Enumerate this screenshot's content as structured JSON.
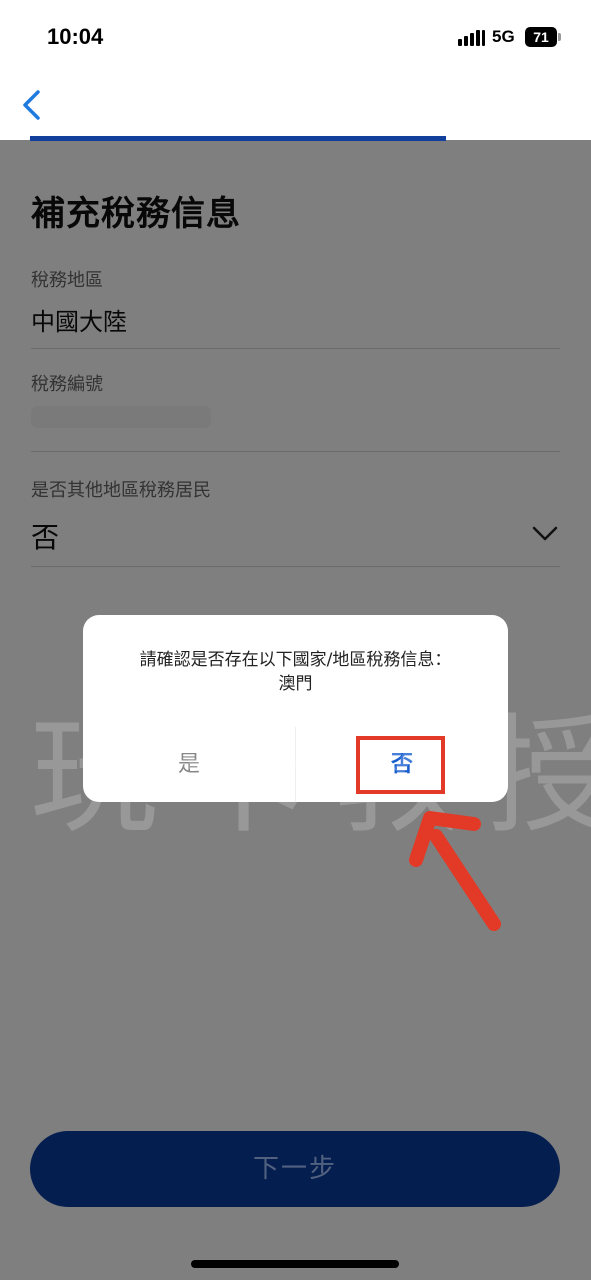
{
  "status_bar": {
    "time": "10:04",
    "network": "5G",
    "battery": "71"
  },
  "nav": {
    "back_icon": "chevron-left-icon",
    "progress": 0.785
  },
  "page": {
    "title": "補充稅務信息",
    "fields": [
      {
        "label": "稅務地區",
        "value": "中國大陸"
      },
      {
        "label": "稅務編號",
        "value": ""
      },
      {
        "label": "是否其他地區稅務居民",
        "value": "否"
      }
    ],
    "next_button": "下一步"
  },
  "dialog": {
    "message_line1": "請確認是否存在以下國家/地區稅務信息：",
    "message_line2": "澳門",
    "yes_label": "是",
    "no_label": "否"
  },
  "watermark": "玩卡教授",
  "colors": {
    "accent": "#0a3da0",
    "link_blue": "#1a5fd0",
    "annotation_red": "#e23a26"
  }
}
